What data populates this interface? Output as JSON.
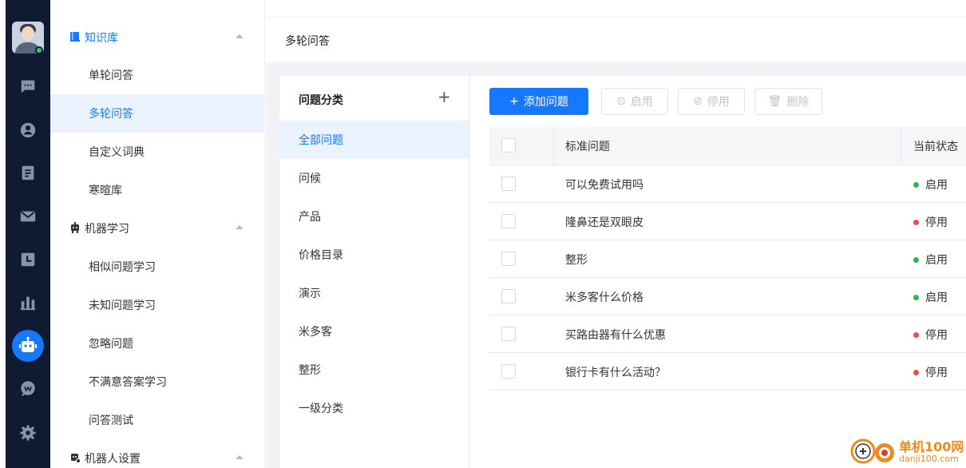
{
  "colors": {
    "rail_bg": "#0f1b33",
    "accent": "#1677ff",
    "enabled": "#2fb44a",
    "disabled": "#f04a4a"
  },
  "rail": {
    "icons": [
      "chat-icon",
      "user-icon",
      "clipboard-icon",
      "mail-icon",
      "clock-icon",
      "bar-chart-icon",
      "robot-icon",
      "message-circle-icon",
      "gear-icon"
    ]
  },
  "menu": {
    "groups": [
      {
        "label": "知识库",
        "icon": "book-icon",
        "items": [
          "单轮问答",
          "多轮问答",
          "自定义词典",
          "寒暄库"
        ]
      },
      {
        "label": "机器学习",
        "icon": "robot-icon",
        "items": [
          "相似问题学习",
          "未知问题学习",
          "忽略问题",
          "不满意答案学习",
          "问答测试"
        ]
      },
      {
        "label": "机器人设置",
        "icon": "robot-settings-icon",
        "items": []
      }
    ],
    "active_item": "多轮问答"
  },
  "header": {
    "title": "多轮问答"
  },
  "categories": {
    "title": "问题分类",
    "add_symbol": "+",
    "items": [
      "全部问题",
      "问候",
      "产品",
      "价格目录",
      "演示",
      "米多客",
      "整形",
      "一级分类"
    ],
    "active": "全部问题"
  },
  "toolbar": {
    "add_label": "添加问题",
    "enable_label": "启用",
    "disable_label": "停用",
    "delete_label": "删除"
  },
  "table": {
    "columns": [
      "标准问题",
      "当前状态"
    ],
    "rows": [
      {
        "question": "可以免费试用吗",
        "status": "启用"
      },
      {
        "question": "隆鼻还是双眼皮",
        "status": "停用"
      },
      {
        "question": "整形",
        "status": "启用"
      },
      {
        "question": "米多客什么价格",
        "status": "启用"
      },
      {
        "question": "买路由器有什么优惠",
        "status": "停用"
      },
      {
        "question": "银行卡有什么活动？",
        "status": "停用"
      }
    ]
  },
  "watermark": {
    "name": "单机100网",
    "url": "danji100.com"
  }
}
